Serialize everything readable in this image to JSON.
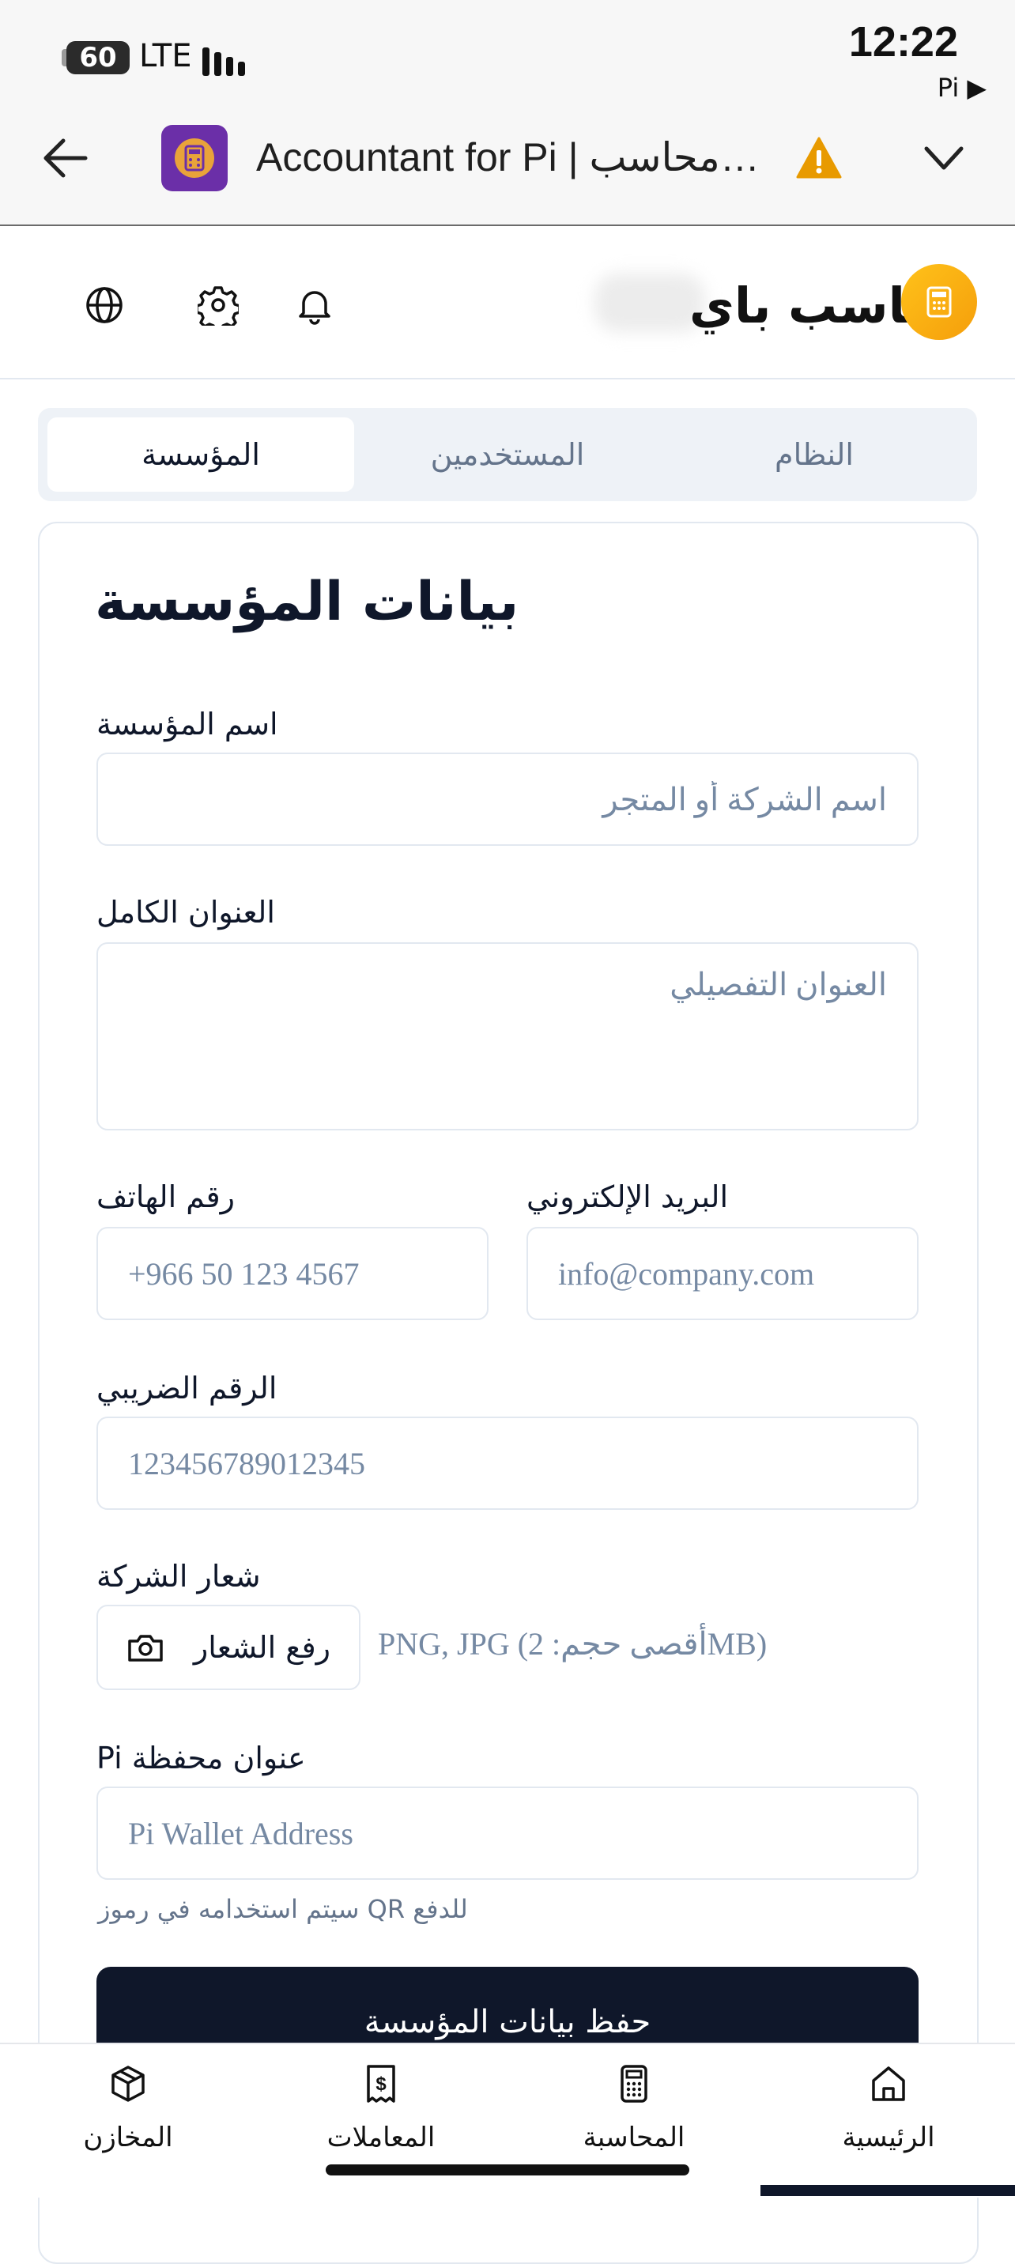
{
  "status_bar": {
    "battery": "60",
    "network": "LTE",
    "time": "12:22",
    "pi_label": "Pi ▶"
  },
  "browser_bar": {
    "title": "Accountant for Pi  | محاسب…"
  },
  "app_header": {
    "brand_name": "محاسب باي"
  },
  "tabs": [
    {
      "label": "المؤسسة",
      "active": true
    },
    {
      "label": "المستخدمين",
      "active": false
    },
    {
      "label": "النظام",
      "active": false
    }
  ],
  "form": {
    "title": "بيانات المؤسسة",
    "org_name": {
      "label": "اسم المؤسسة",
      "placeholder": "اسم الشركة أو المتجر"
    },
    "address": {
      "label": "العنوان الكامل",
      "placeholder": "العنوان التفصيلي"
    },
    "phone": {
      "label": "رقم الهاتف",
      "placeholder": "+966 50 123 4567"
    },
    "email": {
      "label": "البريد الإلكتروني",
      "placeholder": "info@company.com"
    },
    "tax_number": {
      "label": "الرقم الضريبي",
      "placeholder": "123456789012345"
    },
    "logo": {
      "label": "شعار الشركة",
      "button_label": "رفع الشعار",
      "hint": "PNG, JPG (أقصى حجم: 2MB)"
    },
    "wallet": {
      "label": "عنوان محفظة Pi",
      "placeholder": "Pi Wallet Address",
      "helper": "سيتم استخدامه في رموز QR للدفع"
    },
    "save_label": "حفظ بيانات المؤسسة"
  },
  "bottom_nav": [
    {
      "label": "المخازن",
      "icon": "box-icon"
    },
    {
      "label": "المعاملات",
      "icon": "receipt-icon"
    },
    {
      "label": "المحاسبة",
      "icon": "calculator-icon"
    },
    {
      "label": "الرئيسية",
      "icon": "home-icon"
    }
  ],
  "colors": {
    "primary": "#0f172a",
    "muted": "#64748b",
    "placeholder": "#7589a3",
    "border": "#e2e8f0",
    "brand_orange": "#f59e0b",
    "app_purple": "#6b2fa8",
    "warning": "#e89a00"
  }
}
